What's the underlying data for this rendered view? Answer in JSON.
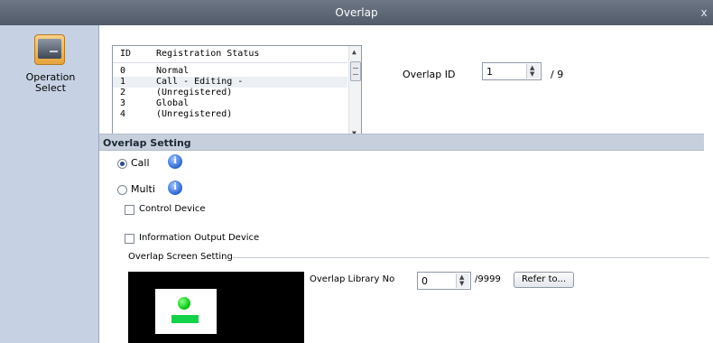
{
  "window": {
    "title": "Overlap",
    "close": "x"
  },
  "sidebar": {
    "operation_select": "Operation\nSelect",
    "icon": "display-device-icon"
  },
  "registration_list": {
    "headers": [
      "ID",
      "Registration Status"
    ],
    "rows": [
      {
        "id": "0",
        "status": "Normal"
      },
      {
        "id": "1",
        "status": "Call - Editing -"
      },
      {
        "id": "2",
        "status": "(Unregistered)"
      },
      {
        "id": "3",
        "status": "Global"
      },
      {
        "id": "4",
        "status": "(Unregistered)"
      }
    ],
    "selected_index": 1
  },
  "overlap_id": {
    "label": "Overlap ID",
    "value": "1",
    "max": "/ 9"
  },
  "section": {
    "title": "Overlap Setting"
  },
  "mode": {
    "call_label": "Call",
    "multi_label": "Multi",
    "selected": "Call"
  },
  "checkboxes": {
    "control_device": "Control Device",
    "info_output_device": "Information Output Device"
  },
  "screen_setting": {
    "group_label": "Overlap Screen Setting",
    "library_label": "Overlap Library No",
    "library_value": "0",
    "library_max": "/9999",
    "refer_button": "Refer to..."
  },
  "colors": {
    "title_bar": "#525b69",
    "sidebar": "#c6d2e3",
    "section_bar": "#c6cfdb",
    "preview_bg": "#000000",
    "preview_lamp": "#06c90f"
  }
}
